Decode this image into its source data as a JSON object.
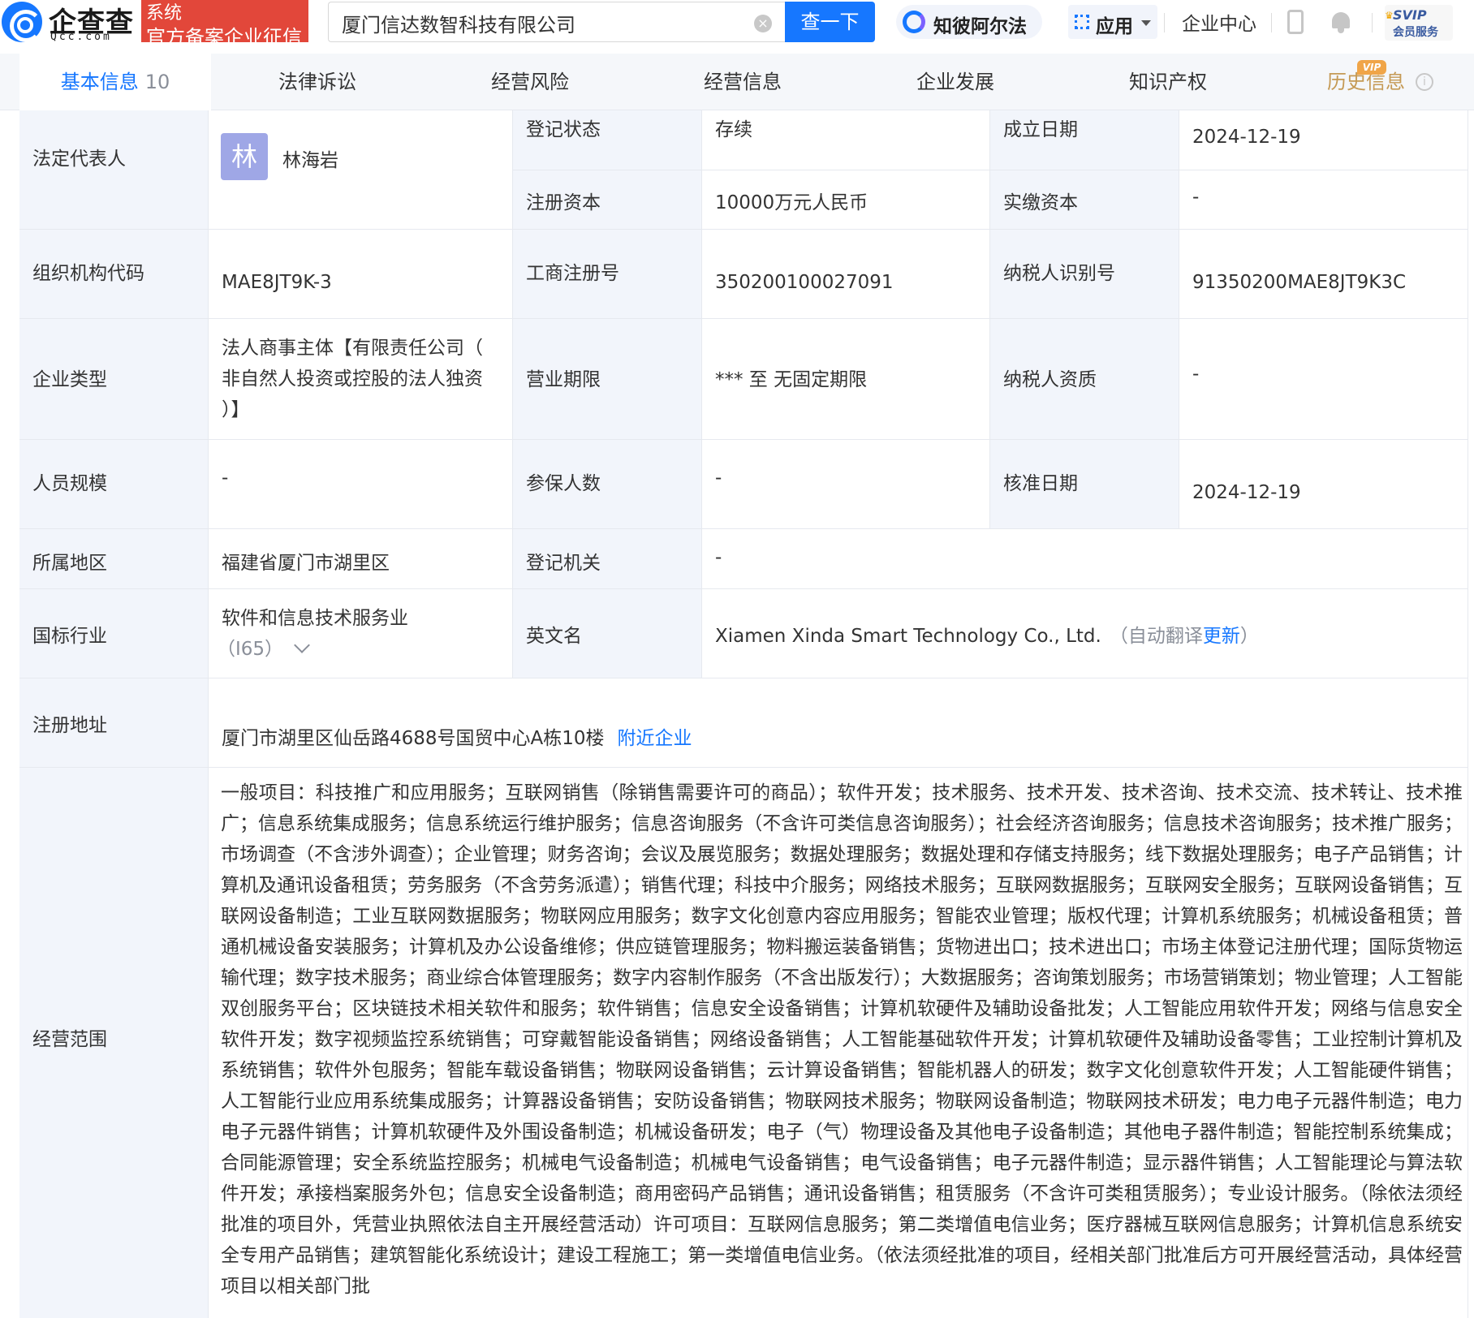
{
  "header": {
    "logo_name": "企查查",
    "logo_sub": "Qcc.com",
    "badge_line1": "系统",
    "badge_line2": "官方备案企业征信",
    "search_value": "厦门信达数智科技有限公司",
    "search_button": "查一下",
    "zhibi_label": "知彼阿尔法",
    "apps_label": "应用",
    "enterprise_center": "企业中心",
    "svip_label": "SVIP",
    "svip_sub": "会员服务"
  },
  "tabs": [
    {
      "label": "基本信息",
      "count": "10"
    },
    {
      "label": "法律诉讼"
    },
    {
      "label": "经营风险"
    },
    {
      "label": "经营信息"
    },
    {
      "label": "企业发展"
    },
    {
      "label": "知识产权"
    },
    {
      "label": "历史信息",
      "badge": "VIP"
    }
  ],
  "info": {
    "legal_rep_label": "法定代表人",
    "legal_rep_avatar": "林",
    "legal_rep_name": "林海岩",
    "reg_status_label": "登记状态",
    "reg_status": "存续",
    "founded_label": "成立日期",
    "founded": "2024-12-19",
    "reg_capital_label": "注册资本",
    "reg_capital": "10000万元人民币",
    "paid_capital_label": "实缴资本",
    "paid_capital": "-",
    "org_code_label": "组织机构代码",
    "org_code": "MAE8JT9K-3",
    "biz_reg_no_label": "工商注册号",
    "biz_reg_no": "350200100027091",
    "taxpayer_id_label": "纳税人识别号",
    "taxpayer_id": "91350200MAE8JT9K3C",
    "ent_type_label": "企业类型",
    "ent_type_l1": "法人商事主体【有限责任公司（",
    "ent_type_l2": "非自然人投资或控股的法人独资",
    "ent_type_l3": "）】",
    "biz_term_label": "营业期限",
    "biz_term": "*** 至 无固定期限",
    "taxpayer_qual_label": "纳税人资质",
    "taxpayer_qual": "-",
    "staff_size_label": "人员规模",
    "staff_size": "-",
    "insured_label": "参保人数",
    "insured": "-",
    "approved_label": "核准日期",
    "approved": "2024-12-19",
    "region_label": "所属地区",
    "region": "福建省厦门市湖里区",
    "reg_authority_label": "登记机关",
    "reg_authority": "-",
    "industry_label": "国标行业",
    "industry": "软件和信息技术服务业",
    "industry_code": "（I65）",
    "english_name_label": "英文名",
    "english_name": "Xiamen Xinda Smart Technology Co., Ltd.",
    "auto_translate": "（自动翻译",
    "update_link": "更新",
    "close_paren": "）",
    "address_label": "注册地址",
    "address": "厦门市湖里区仙岳路4688号国贸中心A栋10楼",
    "nearby_link": "附近企业",
    "scope_label": "经营范围",
    "scope_text": "一般项目：科技推广和应用服务；互联网销售（除销售需要许可的商品）；软件开发；技术服务、技术开发、技术咨询、技术交流、技术转让、技术推广；信息系统集成服务；信息系统运行维护服务；信息咨询服务（不含许可类信息咨询服务）；社会经济咨询服务；信息技术咨询服务；技术推广服务；市场调查（不含涉外调查）；企业管理；财务咨询；会议及展览服务；数据处理服务；数据处理和存储支持服务；线下数据处理服务；电子产品销售；计算机及通讯设备租赁；劳务服务（不含劳务派遣）；销售代理；科技中介服务；网络技术服务；互联网数据服务；互联网安全服务；互联网设备销售；互联网设备制造；工业互联网数据服务；物联网应用服务；数字文化创意内容应用服务；智能农业管理；版权代理；计算机系统服务；机械设备租赁；普通机械设备安装服务；计算机及办公设备维修；供应链管理服务；物料搬运装备销售；货物进出口；技术进出口；市场主体登记注册代理；国际货物运输代理；数字技术服务；商业综合体管理服务；数字内容制作服务（不含出版发行）；大数据服务；咨询策划服务；市场营销策划；物业管理；人工智能双创服务平台；区块链技术相关软件和服务；软件销售；信息安全设备销售；计算机软硬件及辅助设备批发；人工智能应用软件开发；网络与信息安全软件开发；数字视频监控系统销售；可穿戴智能设备销售；网络设备销售；人工智能基础软件开发；计算机软硬件及辅助设备零售；工业控制计算机及系统销售；软件外包服务；智能车载设备销售；物联网设备销售；云计算设备销售；智能机器人的研发；数字文化创意软件开发；人工智能硬件销售；人工智能行业应用系统集成服务；计算器设备销售；安防设备销售；物联网技术服务；物联网设备制造；物联网技术研发；电力电子元器件制造；电力电子元器件销售；计算机软硬件及外围设备制造；机械设备研发；电子（气）物理设备及其他电子设备制造；其他电子器件制造；智能控制系统集成；合同能源管理；安全系统监控服务；机械电气设备制造；机械电气设备销售；电气设备销售；电子元器件制造；显示器件销售；人工智能理论与算法软件开发；承接档案服务外包；信息安全设备制造；商用密码产品销售；通讯设备销售；租赁服务（不含许可类租赁服务）；专业设计服务。（除依法须经批准的项目外，凭营业执照依法自主开展经营活动）许可项目：互联网信息服务；第二类增值电信业务；医疗器械互联网信息服务；计算机信息系统安全专用产品销售；建筑智能化系统设计；建设工程施工；第一类增值电信业务。（依法须经批准的项目，经相关部门批准后方可开展经营活动，具体经营项目以相关部门批"
  }
}
